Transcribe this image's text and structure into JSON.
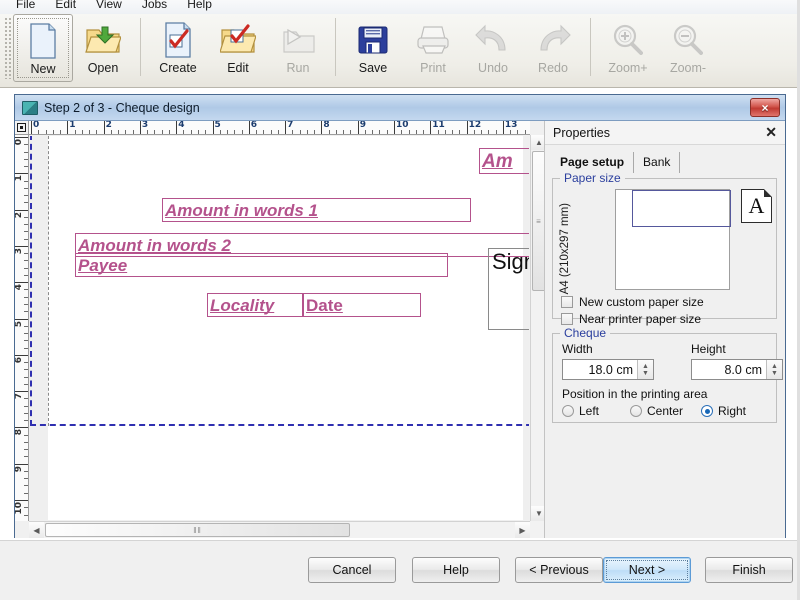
{
  "menu": {
    "items": [
      {
        "label": "File"
      },
      {
        "label": "Edit"
      },
      {
        "label": "View"
      },
      {
        "label": "Jobs"
      },
      {
        "label": "Help"
      }
    ]
  },
  "toolbar": {
    "buttons": [
      {
        "label": "New",
        "icon": "new-document-icon",
        "state": "selected"
      },
      {
        "label": "Open",
        "icon": "open-folder-icon",
        "state": "enabled"
      },
      {
        "label": "Create",
        "icon": "create-document-icon",
        "state": "enabled"
      },
      {
        "label": "Edit",
        "icon": "edit-folder-icon",
        "state": "enabled"
      },
      {
        "label": "Run",
        "icon": "run-icon",
        "state": "disabled"
      },
      {
        "label": "Save",
        "icon": "floppy-save-icon",
        "state": "enabled"
      },
      {
        "label": "Print",
        "icon": "printer-icon",
        "state": "disabled"
      },
      {
        "label": "Undo",
        "icon": "undo-arrow-icon",
        "state": "disabled"
      },
      {
        "label": "Redo",
        "icon": "redo-arrow-icon",
        "state": "disabled"
      },
      {
        "label": "Zoom+",
        "icon": "zoom-in-icon",
        "state": "disabled"
      },
      {
        "label": "Zoom-",
        "icon": "zoom-out-icon",
        "state": "disabled"
      }
    ]
  },
  "window": {
    "title": "Step 2 of 3 - Cheque design",
    "close_label": "×"
  },
  "designer": {
    "h_ruler_labels": [
      "0",
      "1",
      "2",
      "3",
      "4",
      "5",
      "6",
      "7",
      "8",
      "9",
      "10",
      "11",
      "12",
      "13"
    ],
    "v_ruler_labels": [
      "0",
      "1",
      "2",
      "3",
      "4",
      "5",
      "6",
      "7",
      "8",
      "9",
      "10"
    ],
    "fields": [
      {
        "name": "amount-figures-field",
        "text": "Am"
      },
      {
        "name": "amount-in-words-1-field",
        "text": "Amount in words 1"
      },
      {
        "name": "amount-in-words-2-field",
        "text": "Amount in words 2"
      },
      {
        "name": "payee-field",
        "text": "Payee"
      },
      {
        "name": "locality-field",
        "text": "Locality"
      },
      {
        "name": "date-field",
        "text": "Date"
      },
      {
        "name": "signature-field",
        "text": "Sign"
      }
    ],
    "hscroll_grip": "‖‖",
    "vscroll_grip": "≡"
  },
  "properties": {
    "title": "Properties",
    "close_label": "✕",
    "tabs": [
      {
        "label": "Page setup",
        "active": true
      },
      {
        "label": "Bank",
        "active": false
      }
    ],
    "paper_size": {
      "group_label": "Paper size",
      "rotated_label": "A4 (210x297 mm)",
      "format_glyph": "A",
      "checkboxes": [
        {
          "label": "New custom paper size",
          "checked": false
        },
        {
          "label": "Near printer paper size",
          "checked": false
        }
      ]
    },
    "cheque": {
      "group_label": "Cheque",
      "width_label": "Width",
      "width_value": "18.0 cm",
      "height_label": "Height",
      "height_value": "8.0 cm",
      "position_label": "Position in the printing area",
      "position_options": [
        {
          "label": "Left",
          "selected": false
        },
        {
          "label": "Center",
          "selected": false
        },
        {
          "label": "Right",
          "selected": true
        }
      ]
    }
  },
  "footer": {
    "buttons": [
      {
        "label": "Cancel",
        "default": false
      },
      {
        "label": "Help",
        "default": false
      },
      {
        "label": "< Previous",
        "default": false
      },
      {
        "label": "Next >",
        "default": true
      },
      {
        "label": "Finish",
        "default": false
      }
    ]
  },
  "colors": {
    "field_magenta": "#b4528c",
    "guide_blue": "#2f2fb0",
    "accent_blue": "#1767b7",
    "titlebar": "#afc9e6"
  }
}
